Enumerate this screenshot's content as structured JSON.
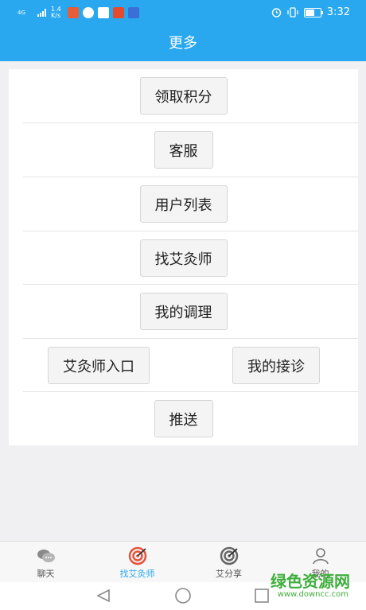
{
  "status_bar": {
    "network": "4G",
    "speed": "1.4 K/s",
    "time": "3:32",
    "battery_level": 0.6
  },
  "header": {
    "title": "更多"
  },
  "menu": {
    "items": [
      {
        "label": "领取积分"
      },
      {
        "label": "客服"
      },
      {
        "label": "用户列表"
      },
      {
        "label": "找艾灸师"
      },
      {
        "label": "我的调理"
      }
    ],
    "pair": [
      {
        "label": "艾灸师入口"
      },
      {
        "label": "我的接诊"
      }
    ],
    "last": {
      "label": "推送"
    }
  },
  "tabs": [
    {
      "label": "聊天",
      "icon": "chat-icon"
    },
    {
      "label": "找艾灸师",
      "icon": "target-icon",
      "active": true
    },
    {
      "label": "艾分享",
      "icon": "target-icon"
    },
    {
      "label": "我的",
      "icon": "person-icon"
    }
  ],
  "watermark": {
    "text": "绿色资源网",
    "url": "www.downcc.com"
  },
  "colors": {
    "primary": "#29a8f0",
    "active_icon": "#e4533a",
    "watermark": "#3fae3c"
  }
}
